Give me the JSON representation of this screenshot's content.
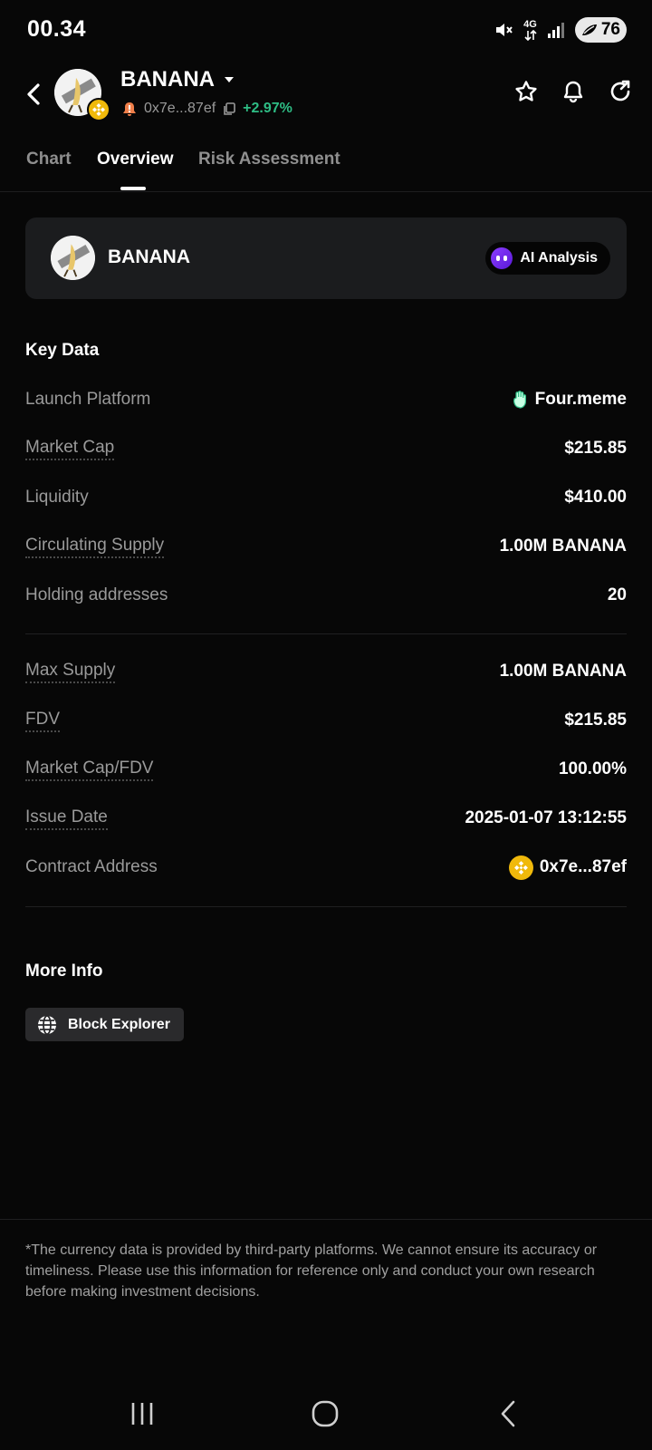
{
  "status_bar": {
    "time": "00.34",
    "network": "4G",
    "battery": "76",
    "icons": [
      "mute-icon",
      "network-4g-icon",
      "signal-icon",
      "battery-icon"
    ]
  },
  "header": {
    "token_symbol": "BANANA",
    "address_short": "0x7e...87ef",
    "price_change": "+2.97%",
    "icons": [
      "back-icon",
      "dropdown-caret-icon",
      "warning-bell-icon",
      "copy-icon",
      "star-icon",
      "bell-icon",
      "share-icon"
    ]
  },
  "tabs": [
    "Chart",
    "Overview",
    "Risk Assessment"
  ],
  "active_tab": "Overview",
  "token_card": {
    "name": "BANANA",
    "ai_button": "AI Analysis"
  },
  "key_data": {
    "title": "Key Data",
    "rows_top": [
      {
        "label": "Launch Platform",
        "value": "Four.meme"
      },
      {
        "label": "Market Cap",
        "value": "$215.85"
      },
      {
        "label": "Liquidity",
        "value": "$410.00"
      },
      {
        "label": "Circulating Supply",
        "value": "1.00M BANANA"
      },
      {
        "label": "Holding addresses",
        "value": "20"
      }
    ],
    "rows_bottom": [
      {
        "label": "Max Supply",
        "value": "1.00M BANANA"
      },
      {
        "label": "FDV",
        "value": "$215.85"
      },
      {
        "label": "Market Cap/FDV",
        "value": "100.00%"
      },
      {
        "label": "Issue Date",
        "value": "2025-01-07 13:12:55"
      },
      {
        "label": "Contract Address",
        "value": "0x7e...87ef"
      }
    ]
  },
  "more_info": {
    "title": "More Info",
    "block_explorer": "Block Explorer"
  },
  "disclaimer": "*The currency data is provided by third-party platforms. We cannot ensure its accuracy or timeliness. Please use this information for reference only and conduct your own research before making investment decisions.",
  "colors": {
    "background": "#070707",
    "positive": "#2ebd85",
    "bnb_gold": "#f0b90b",
    "ai_purple": "#8b3dff"
  }
}
